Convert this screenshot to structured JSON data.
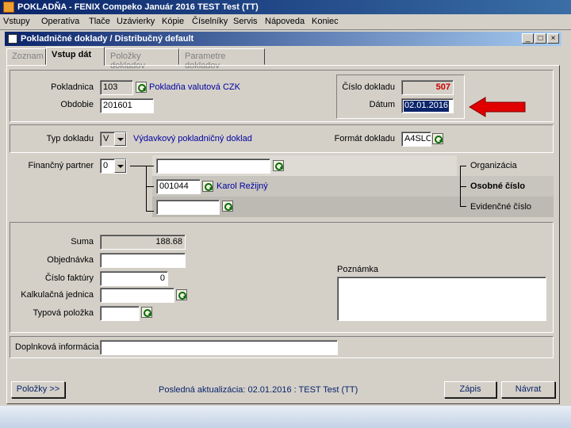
{
  "app": {
    "title": "POKLADŇA - FENIX Compeko  Január 2016  TEST Test  (TT)"
  },
  "menu": [
    "Vstupy",
    "Operatíva",
    "Tlače",
    "Uzávierky",
    "Kópie",
    "Číselníky",
    "Servis",
    "Nápoveda",
    "Koniec"
  ],
  "window": {
    "title": "Pokladničné doklady / Distribučný default",
    "minimize": "_",
    "maximize": "□",
    "close": "×"
  },
  "tabs": [
    "Zoznam",
    "Vstup dát",
    "Položky dokladov",
    "Parametre dokladov"
  ],
  "header": {
    "pokladnica_label": "Pokladnica",
    "pokladnica_value": "103",
    "pokladnica_name": "Pokladňa valutová CZK",
    "obdobie_label": "Obdobie",
    "obdobie_value": "201601",
    "cislo_label": "Číslo dokladu",
    "cislo_value": "507",
    "datum_label": "Dátum",
    "datum_value": "02.01.2016"
  },
  "typ": {
    "label": "Typ dokladu",
    "value": "V",
    "name": "Výdavkový pokladničný doklad",
    "format_label": "Formát dokladu",
    "format_value": "A4SLO"
  },
  "partner": {
    "label": "Finančný partner",
    "selector": "0",
    "organizacia_value": "",
    "osobne_value": "001044",
    "osobne_name": "Karol Režijný",
    "evidencne_value": "",
    "organizacia_label": "Organizácia",
    "osobne_label": "Osobné číslo",
    "evidencne_label": "Evidenčné číslo"
  },
  "details": {
    "suma_label": "Suma",
    "suma_value": "188.68",
    "objednavka_label": "Objednávka",
    "objednavka_value": "",
    "faktura_label": "Číslo faktúry",
    "faktura_value": "0",
    "kalkulacna_label": "Kalkulačná jednica",
    "kalkulacna_value": "",
    "typova_label": "Typová položka",
    "typova_value": "",
    "poznamka_label": "Poznámka",
    "poznamka_value": ""
  },
  "doplnkova": {
    "label": "Doplnková informácia",
    "value": ""
  },
  "footer": {
    "polozky_button": "Položky >>",
    "status": "Posledná aktualizácia: 02.01.2016 : TEST Test  (TT)",
    "zapis_button": "Zápis",
    "navrat_button": "Návrat"
  },
  "colors": {
    "arrow": "#e00000",
    "cislo": "#cc0000",
    "link": "#0000a0"
  }
}
